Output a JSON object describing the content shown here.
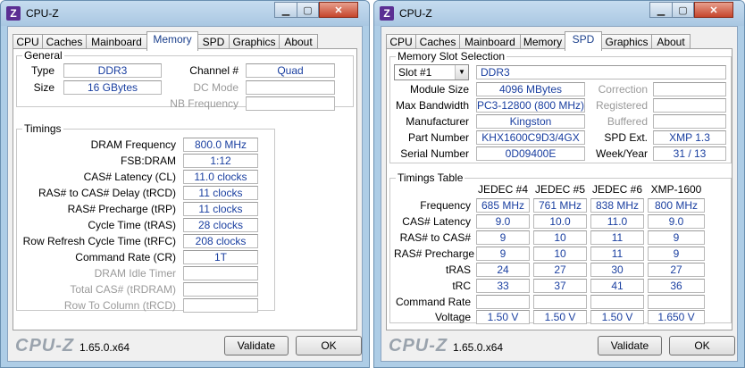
{
  "left": {
    "title": "CPU-Z",
    "tabs": [
      "CPU",
      "Caches",
      "Mainboard",
      "Memory",
      "SPD",
      "Graphics",
      "About"
    ],
    "active_tab": "Memory",
    "general": {
      "group_title": "General",
      "type_label": "Type",
      "type_value": "DDR3",
      "size_label": "Size",
      "size_value": "16 GBytes",
      "channel_label": "Channel #",
      "channel_value": "Quad",
      "dc_mode_label": "DC Mode",
      "dc_mode_value": "",
      "nb_freq_label": "NB Frequency",
      "nb_freq_value": ""
    },
    "timings": {
      "group_title": "Timings",
      "rows": [
        {
          "label": "DRAM Frequency",
          "value": "800.0 MHz",
          "enabled": true
        },
        {
          "label": "FSB:DRAM",
          "value": "1:12",
          "enabled": true
        },
        {
          "label": "CAS# Latency (CL)",
          "value": "11.0 clocks",
          "enabled": true
        },
        {
          "label": "RAS# to CAS# Delay (tRCD)",
          "value": "11 clocks",
          "enabled": true
        },
        {
          "label": "RAS# Precharge (tRP)",
          "value": "11 clocks",
          "enabled": true
        },
        {
          "label": "Cycle Time (tRAS)",
          "value": "28 clocks",
          "enabled": true
        },
        {
          "label": "Row Refresh Cycle Time (tRFC)",
          "value": "208 clocks",
          "enabled": true
        },
        {
          "label": "Command Rate (CR)",
          "value": "1T",
          "enabled": true
        },
        {
          "label": "DRAM Idle Timer",
          "value": "",
          "enabled": false
        },
        {
          "label": "Total CAS# (tRDRAM)",
          "value": "",
          "enabled": false
        },
        {
          "label": "Row To Column (tRCD)",
          "value": "",
          "enabled": false
        }
      ]
    },
    "footer": {
      "logo": "CPU-Z",
      "version": "1.65.0.x64",
      "validate": "Validate",
      "ok": "OK"
    }
  },
  "right": {
    "title": "CPU-Z",
    "tabs": [
      "CPU",
      "Caches",
      "Mainboard",
      "Memory",
      "SPD",
      "Graphics",
      "About"
    ],
    "active_tab": "SPD",
    "slot": {
      "group_title": "Memory Slot Selection",
      "slot_value": "Slot #1",
      "type_value": "DDR3",
      "rows": [
        {
          "label": "Module Size",
          "value": "4096 MBytes",
          "rlabel": "Correction",
          "rvalue": "",
          "renabled": false
        },
        {
          "label": "Max Bandwidth",
          "value": "PC3-12800 (800 MHz)",
          "rlabel": "Registered",
          "rvalue": "",
          "renabled": false
        },
        {
          "label": "Manufacturer",
          "value": "Kingston",
          "rlabel": "Buffered",
          "rvalue": "",
          "renabled": false
        },
        {
          "label": "Part Number",
          "value": "KHX1600C9D3/4GX",
          "rlabel": "SPD Ext.",
          "rvalue": "XMP 1.3",
          "renabled": true
        },
        {
          "label": "Serial Number",
          "value": "0D09400E",
          "rlabel": "Week/Year",
          "rvalue": "31 / 13",
          "renabled": true
        }
      ]
    },
    "timings_table": {
      "group_title": "Timings Table",
      "columns": [
        "JEDEC #4",
        "JEDEC #5",
        "JEDEC #6",
        "XMP-1600"
      ],
      "rows": [
        {
          "label": "Frequency",
          "values": [
            "685 MHz",
            "761 MHz",
            "838 MHz",
            "800 MHz"
          ]
        },
        {
          "label": "CAS# Latency",
          "values": [
            "9.0",
            "10.0",
            "11.0",
            "9.0"
          ]
        },
        {
          "label": "RAS# to CAS#",
          "values": [
            "9",
            "10",
            "11",
            "9"
          ]
        },
        {
          "label": "RAS# Precharge",
          "values": [
            "9",
            "10",
            "11",
            "9"
          ]
        },
        {
          "label": "tRAS",
          "values": [
            "24",
            "27",
            "30",
            "27"
          ]
        },
        {
          "label": "tRC",
          "values": [
            "33",
            "37",
            "41",
            "36"
          ]
        },
        {
          "label": "Command Rate",
          "values": [
            "",
            "",
            "",
            ""
          ]
        },
        {
          "label": "Voltage",
          "values": [
            "1.50 V",
            "1.50 V",
            "1.50 V",
            "1.650 V"
          ]
        }
      ]
    },
    "footer": {
      "logo": "CPU-Z",
      "version": "1.65.0.x64",
      "validate": "Validate",
      "ok": "OK"
    }
  }
}
